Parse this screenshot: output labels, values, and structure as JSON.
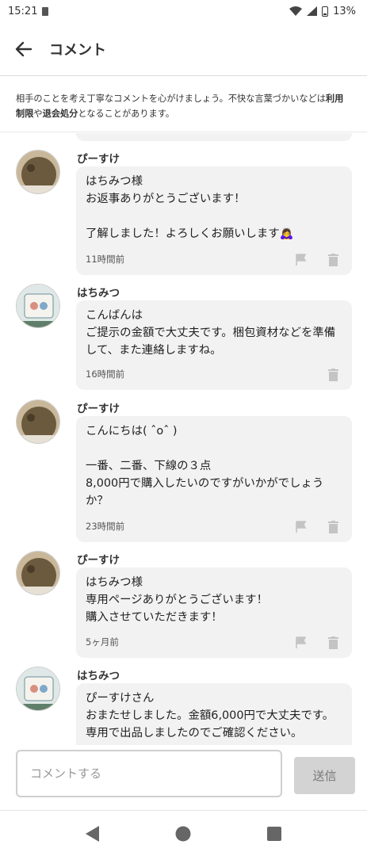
{
  "status_bar": {
    "time": "15:21",
    "battery": "13%"
  },
  "header": {
    "title": "コメント"
  },
  "notice": {
    "part1": "相手のことを考え丁寧なコメントを心がけましょう。不快な言葉づかいなどは",
    "bold1": "利用制限",
    "part2": "や",
    "bold2": "退会処分",
    "part3": "となることがあります。"
  },
  "comments": [
    {
      "user": "ぴーすけ",
      "text": "はちみつ様\nお返事ありがとうございます！\n\n了解しました！よろしくお願いします🙇‍♀️",
      "time": "11時間前",
      "flag": true
    },
    {
      "user": "はちみつ",
      "text": "こんばんは\nご提示の金額で大丈夫です。梱包資材などを準備して、また連絡しますね。",
      "time": "16時間前",
      "flag": false
    },
    {
      "user": "ぴーすけ",
      "text": "こんにちは( ˆoˆ )\n\n一番、二番、下線の３点\n8,000円で購入したいのですがいかがでしょうか？",
      "time": "23時間前",
      "flag": true
    },
    {
      "user": "ぴーすけ",
      "text": "はちみつ様\n専用ページありがとうございます！\n購入させていただきます！",
      "time": "5ヶ月前",
      "flag": true
    },
    {
      "user": "はちみつ",
      "text": "ぴーすけさん\nおまたせしました。金額6,000円で大丈夫です。\n専用で出品しましたのでご確認ください。",
      "time": "",
      "flag": false
    }
  ],
  "input": {
    "placeholder": "コメントする",
    "send_label": "送信"
  },
  "icons": {
    "back": "arrow-left-icon",
    "flag": "flag-icon",
    "trash": "trash-icon",
    "nav": [
      "nav-back-icon",
      "nav-home-icon",
      "nav-recents-icon"
    ]
  },
  "colors": {
    "bubble": "#f2f2f2",
    "icon_muted": "#c4c4c4",
    "send_disabled": "#d3d3d3"
  }
}
